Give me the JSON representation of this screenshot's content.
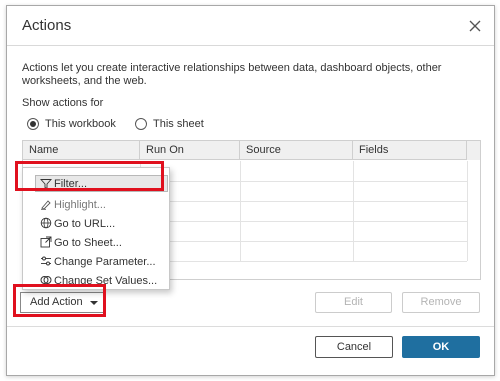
{
  "dialog": {
    "title": "Actions",
    "description": "Actions let you create interactive relationships between data, dashboard objects, other worksheets, and the web.",
    "show_actions_for_label": "Show actions for",
    "radio_options": [
      {
        "label": "This workbook",
        "selected": true
      },
      {
        "label": "This sheet",
        "selected": false
      }
    ]
  },
  "table": {
    "columns": [
      "Name",
      "Run On",
      "Source",
      "Fields"
    ]
  },
  "add_action_menu": {
    "items": [
      {
        "label": "Filter...",
        "icon": "filter-icon",
        "selected": true
      },
      {
        "label": "Highlight...",
        "icon": "highlight-icon",
        "selected": false
      },
      {
        "label": "Go to URL...",
        "icon": "globe-icon",
        "selected": false
      },
      {
        "label": "Go to Sheet...",
        "icon": "go-to-sheet-icon",
        "selected": false
      },
      {
        "label": "Change Parameter...",
        "icon": "parameter-icon",
        "selected": false
      },
      {
        "label": "Change Set Values...",
        "icon": "set-icon",
        "selected": false
      }
    ]
  },
  "buttons": {
    "add_action": "Add Action",
    "edit": "Edit",
    "remove": "Remove",
    "cancel": "Cancel",
    "ok": "OK"
  },
  "colors": {
    "primary": "#1f6fa0",
    "highlight_annotation": "#e0101e"
  }
}
